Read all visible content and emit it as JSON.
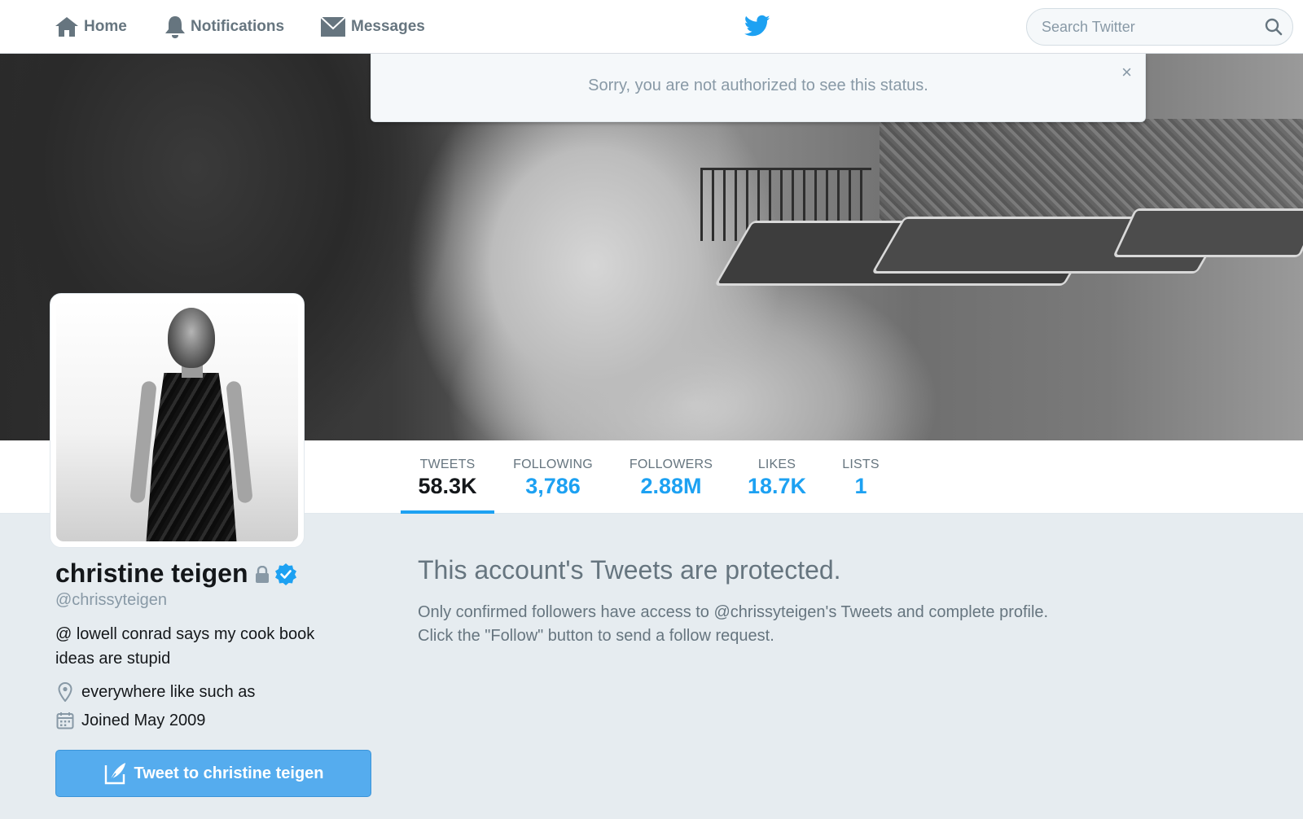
{
  "topbar": {
    "nav": [
      {
        "label": "Home",
        "icon": "home-icon"
      },
      {
        "label": "Notifications",
        "icon": "bell-icon"
      },
      {
        "label": "Messages",
        "icon": "envelope-icon"
      }
    ],
    "logo": "twitter-bird-icon",
    "search": {
      "placeholder": "Search Twitter",
      "value": "",
      "icon": "search-icon"
    }
  },
  "alert": {
    "message": "Sorry, you are not authorized to see this status.",
    "close_label": "×"
  },
  "stats": [
    {
      "label": "TWEETS",
      "value": "58.3K",
      "active": true
    },
    {
      "label": "FOLLOWING",
      "value": "3,786"
    },
    {
      "label": "FOLLOWERS",
      "value": "2.88M"
    },
    {
      "label": "LIKES",
      "value": "18.7K"
    },
    {
      "label": "LISTS",
      "value": "1"
    }
  ],
  "profile": {
    "name": "christine teigen",
    "screen_name": "@chrissyteigen",
    "bio": "@ lowell conrad says my cook book ideas are stupid",
    "location": "everywhere like such as",
    "joined": "Joined May 2009",
    "tweet_to_label": "Tweet to christine teigen",
    "badges": [
      "lock-icon",
      "verified-badge-icon"
    ]
  },
  "protected": {
    "title": "This account's Tweets are protected.",
    "line1": "Only confirmed followers have access to @chrissyteigen's Tweets and complete profile.",
    "line2": "Click the \"Follow\" button to send a follow request."
  },
  "colors": {
    "accent": "#1da1f2",
    "button": "#55acee",
    "muted": "#66757f",
    "background": "#e6ecf0"
  }
}
